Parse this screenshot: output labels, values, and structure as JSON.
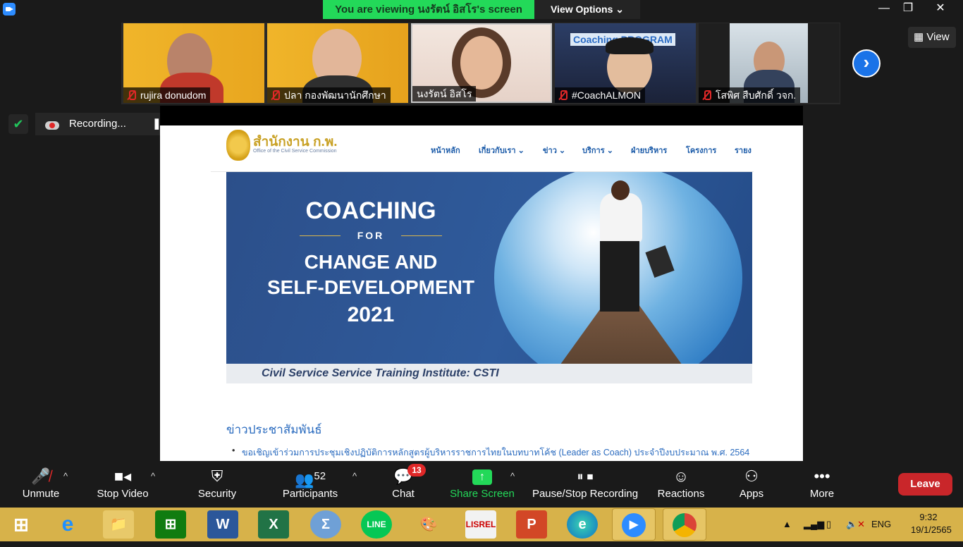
{
  "banner": {
    "viewing_text": "You  are  viewing นงรัตน์ อิสโร's screen",
    "view_options": "View Options"
  },
  "window": {
    "min": "—",
    "max": "❐",
    "close": "✕"
  },
  "participants": [
    {
      "name": "rujira donudom",
      "muted": true
    },
    {
      "name": "ปลา กองพัฒนานักศึกษา",
      "muted": true
    },
    {
      "name": "นงรัตน์ อิสโร",
      "muted": false
    },
    {
      "name": "#CoachALMON",
      "muted": true
    },
    {
      "name": "โสพิศ สืบศักดิ์ วจก.",
      "muted": true
    }
  ],
  "view_button": "View",
  "recording": {
    "label": "Recording..."
  },
  "website": {
    "logo_th": "สำนักงาน ก.พ.",
    "logo_en": "Office of the Civil Service Commission",
    "nav": [
      "หน้าหลัก",
      "เกี่ยวกับเรา ⌄",
      "ข่าว ⌄",
      "บริการ ⌄",
      "ฝ่ายบริหาร",
      "โครงการ",
      "รายง"
    ],
    "banner_line1": "COACHING",
    "banner_line2": "FOR",
    "banner_line3": "CHANGE AND",
    "banner_line4": "SELF-DEVELOPMENT",
    "banner_line5": "2021",
    "banner_footer": "Civil Service Service Training Institute: CSTI",
    "thumb_overlay": "Coaching PROGRAM",
    "news_title": "ข่าวประชาสัมพันธ์",
    "news_item": "ขอเชิญเข้าร่วมการประชุมเชิงปฏิบัติการหลักสูตรผู้บริหารราชการไทยในบทบาทโค้ช (Leader as Coach) ประจำปีงบประมาณ พ.ศ. 2564"
  },
  "toolbar": {
    "unmute": "Unmute",
    "stop_video": "Stop Video",
    "security": "Security",
    "participants": "Participants",
    "participants_count": "52",
    "chat": "Chat",
    "chat_badge": "13",
    "share": "Share Screen",
    "recording": "Pause/Stop Recording",
    "reactions": "Reactions",
    "apps": "Apps",
    "more": "More",
    "leave": "Leave"
  },
  "taskbar": {
    "lang": "ENG",
    "time": "9:32",
    "date": "19/1/2565"
  },
  "colors": {
    "share_green": "#23d959",
    "leave_red": "#c9262a",
    "taskbar": "#d7b24a"
  }
}
